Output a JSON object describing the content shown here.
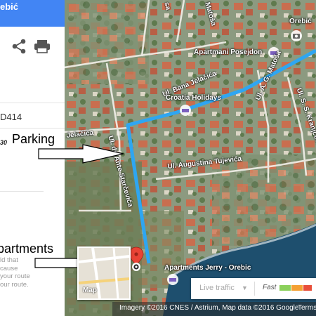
{
  "panel": {
    "header_title": "ebić",
    "route_code": "D414",
    "route_time": "30",
    "warning_text": "ld that\ncause\nyour route\nour route."
  },
  "map": {
    "road_labels": {
      "bana_jelacica": "Ul. Bana Jelačića",
      "ante_starcevica": "Ul. dr. Ante Starčevića",
      "augustina_tujevica": "Ul. Augustina Tujevića",
      "a_g_matosa": "Ul. A. G. Matoša",
      "s_s_kranjcevica": "Ul. S. S. Kranjčevića",
      "jelacica_left": "Jelačića",
      "matosa_top": "Matoša",
      "sa_top": "sa"
    },
    "places": {
      "orebic": "Orebić",
      "apartmani_posejdon": "Apartmani Posejdon",
      "croatia_holidays": "Croatia Holidays",
      "apartments_jerry": "Apartments Jerry - Orebic"
    },
    "colors": {
      "route": "#2ea6f2",
      "marker": "#e94335"
    }
  },
  "annotations": {
    "parking": "Parking",
    "apartments": "partments"
  },
  "thumbnail": {
    "label": "Map"
  },
  "traffic": {
    "live_label": "Live traffic",
    "fast_label": "Fast",
    "colors": [
      "#8bd05b",
      "#f4a033",
      "#e84e3a",
      "#9d2a2a"
    ]
  },
  "attribution": {
    "imagery": "Imagery ©2016 CNES / Astrium, Map data ©2016 Google",
    "terms": "Terms"
  }
}
